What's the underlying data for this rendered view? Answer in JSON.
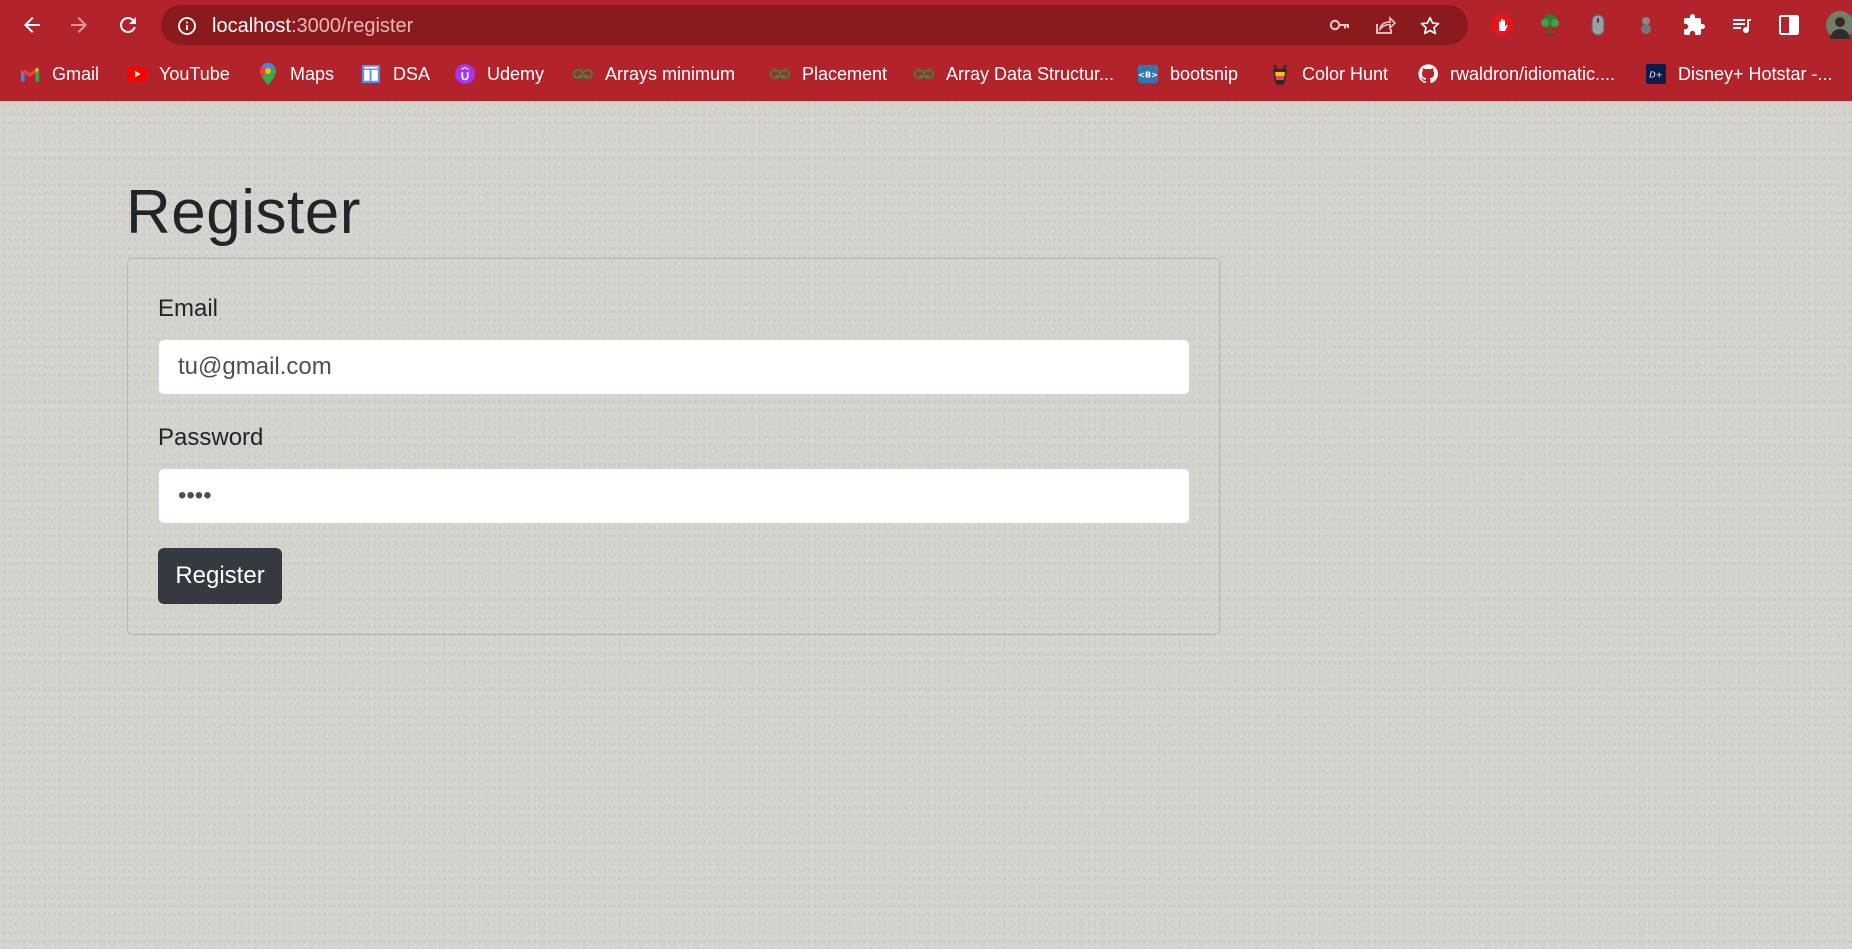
{
  "browser": {
    "url_host": "localhost",
    "url_path": ":3000/register",
    "bookmarks": [
      {
        "label": "Gmail",
        "icon": "gmail-icon"
      },
      {
        "label": "YouTube",
        "icon": "youtube-icon"
      },
      {
        "label": "Maps",
        "icon": "maps-icon"
      },
      {
        "label": "DSA",
        "icon": "dsa-icon"
      },
      {
        "label": "Udemy",
        "icon": "udemy-icon"
      },
      {
        "label": "Arrays minimum",
        "icon": "geeksforgeeks-icon"
      },
      {
        "label": "Placement",
        "icon": "geeksforgeeks-icon"
      },
      {
        "label": "Array Data Structur...",
        "icon": "geeksforgeeks-icon"
      },
      {
        "label": "bootsnip",
        "icon": "bootsnip-icon"
      },
      {
        "label": "Color Hunt",
        "icon": "color-hunt-icon"
      },
      {
        "label": "rwaldron/idiomatic....",
        "icon": "github-icon"
      },
      {
        "label": "Disney+ Hotstar -...",
        "icon": "hotstar-icon"
      }
    ]
  },
  "page": {
    "title": "Register",
    "form": {
      "email_label": "Email",
      "email_value": "tu@gmail.com",
      "password_label": "Password",
      "password_value": "abcd",
      "submit_label": "Register"
    }
  },
  "colors": {
    "chrome": "#b2232b",
    "omnibox": "#8b1a1f",
    "page_background": "#d5d4cf",
    "button": "#343a40"
  }
}
